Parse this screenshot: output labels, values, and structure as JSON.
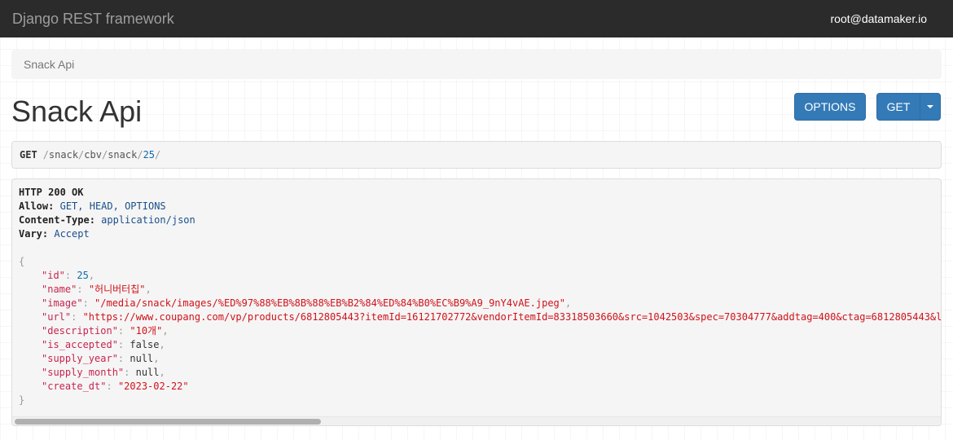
{
  "navbar": {
    "brand": "Django REST framework",
    "user": "root@datamaker.io"
  },
  "breadcrumb": {
    "label": "Snack Api"
  },
  "page": {
    "title": "Snack Api"
  },
  "buttons": {
    "options_label": "OPTIONS",
    "get_label": "GET",
    "caret_icon": "chevron-down-icon"
  },
  "request": {
    "method": "GET",
    "path_segments": [
      "snack",
      "cbv",
      "snack",
      "25"
    ]
  },
  "response": {
    "status": "HTTP 200 OK",
    "headers": [
      {
        "key": "Allow:",
        "value": "GET, HEAD, OPTIONS"
      },
      {
        "key": "Content-Type:",
        "value": "application/json"
      },
      {
        "key": "Vary:",
        "value": "Accept"
      }
    ],
    "open_brace": "{",
    "close_brace": "}",
    "fields": {
      "id": {
        "key": "\"id\"",
        "value": "25"
      },
      "name": {
        "key": "\"name\"",
        "value": "\"허니버터칩\""
      },
      "image": {
        "key": "\"image\"",
        "value": "\"/media/snack/images/%ED%97%88%EB%8B%88%EB%B2%84%ED%84%B0%EC%B9%A9_9nY4vAE.jpeg\""
      },
      "url": {
        "key": "\"url\"",
        "value": "\"https://www.coupang.com/vp/products/6812805443?itemId=16121702772&vendorItemId=83318503660&src=1042503&spec=70304777&addtag=400&ctag=6812805443&l"
      },
      "description": {
        "key": "\"description\"",
        "value": "\"10개\""
      },
      "is_accepted": {
        "key": "\"is_accepted\"",
        "value": "false"
      },
      "supply_year": {
        "key": "\"supply_year\"",
        "value": "null"
      },
      "supply_month": {
        "key": "\"supply_month\"",
        "value": "null"
      },
      "create_dt": {
        "key": "\"create_dt\"",
        "value": "\"2023-02-22\""
      }
    }
  },
  "colors": {
    "navbar_bg": "#2b2b2b",
    "primary_button": "#337ab7",
    "json_key": "#c7254e",
    "json_string": "#d0121a",
    "json_number": "#0e6bac"
  }
}
